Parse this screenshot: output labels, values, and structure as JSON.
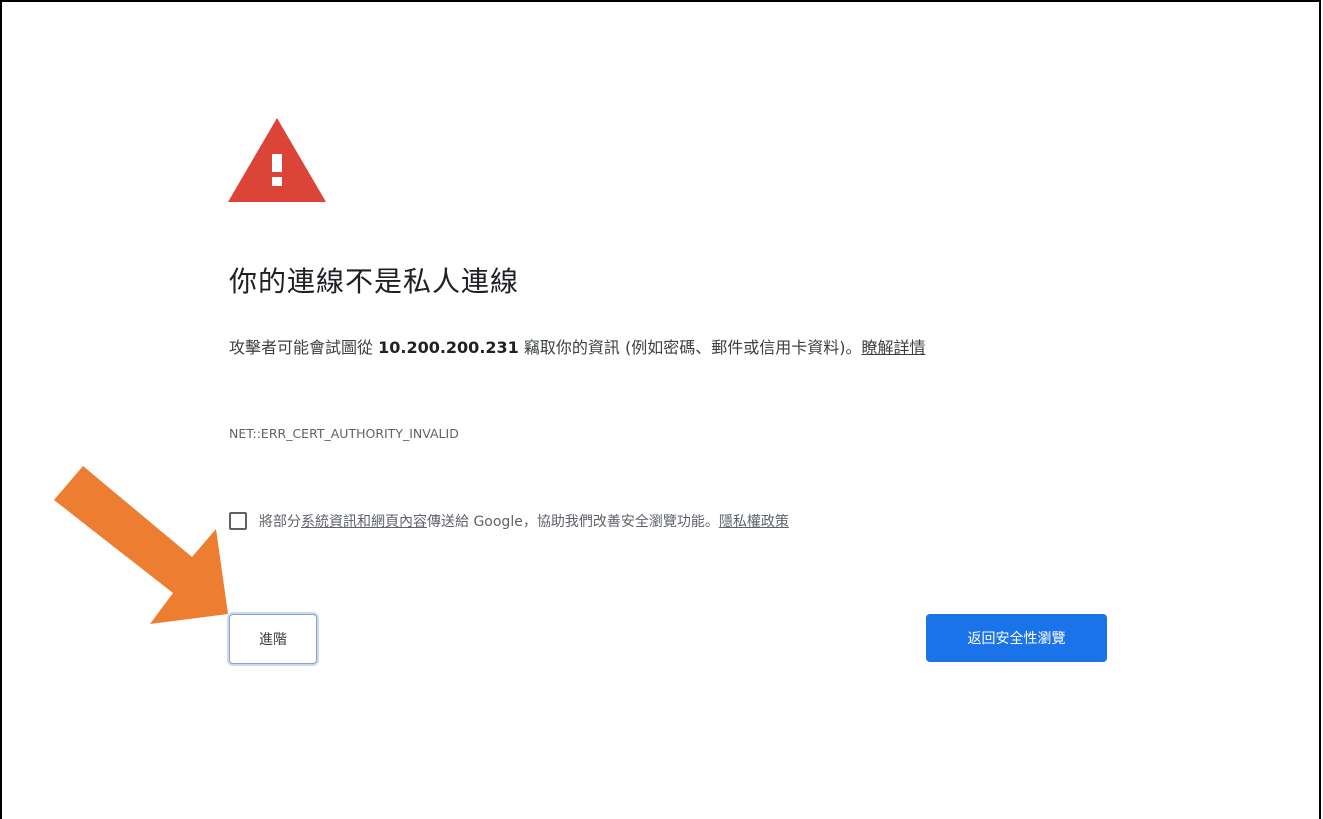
{
  "interstitial": {
    "title": "你的連線不是私人連線",
    "description_before": "攻擊者可能會試圖從 ",
    "host": "10.200.200.231",
    "description_after": " 竊取你的資訊 (例如密碼、郵件或信用卡資料)。",
    "learn_more_link": "瞭解詳情",
    "error_code": "NET::ERR_CERT_AUTHORITY_INVALID",
    "optin": {
      "checked": false,
      "text_before": "將部分",
      "link_text": "系統資訊和網頁內容",
      "text_after": "傳送給 Google，協助我們改善安全瀏覽功能。",
      "privacy_link": "隱私權政策"
    },
    "advanced_button": "進階",
    "back_button": "返回安全性瀏覽"
  },
  "colors": {
    "warning_icon": "#db4437",
    "primary_button": "#1a73e8",
    "annotation_arrow": "#ed7d31"
  }
}
